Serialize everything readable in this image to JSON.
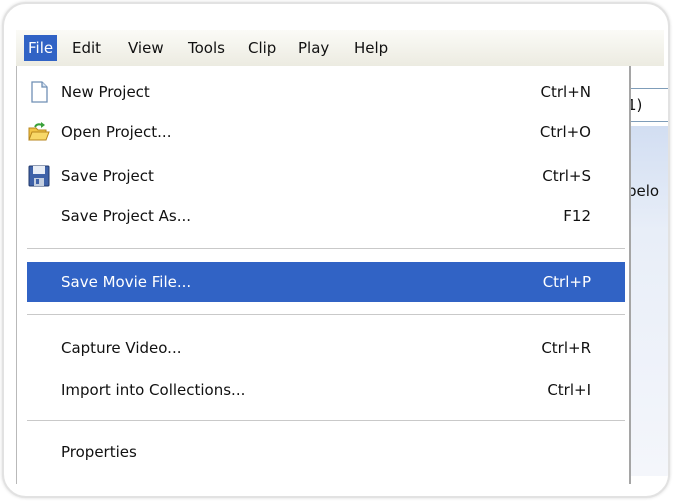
{
  "menubar": {
    "items": [
      {
        "label": "File",
        "active": true
      },
      {
        "label": "Edit"
      },
      {
        "label": "View"
      },
      {
        "label": "Tools"
      },
      {
        "label": "Clip"
      },
      {
        "label": "Play"
      },
      {
        "label": "Help"
      }
    ]
  },
  "background": {
    "combo_text": "1)",
    "panel_text": "belo"
  },
  "file_menu": {
    "items": [
      {
        "label": "New Project",
        "shortcut": "Ctrl+N",
        "icon": "new-document-icon"
      },
      {
        "label": "Open Project...",
        "shortcut": "Ctrl+O",
        "icon": "open-folder-icon"
      },
      {
        "label": "Save Project",
        "shortcut": "Ctrl+S",
        "icon": "floppy-disk-icon"
      },
      {
        "label": "Save Project As...",
        "shortcut": "F12"
      },
      {
        "label": "Save Movie File...",
        "shortcut": "Ctrl+P",
        "highlighted": true
      },
      {
        "label": "Capture Video...",
        "shortcut": "Ctrl+R"
      },
      {
        "label": "Import into Collections...",
        "shortcut": "Ctrl+I"
      },
      {
        "label": "Properties",
        "shortcut": ""
      }
    ]
  },
  "colors": {
    "highlight": "#3163c5",
    "menubar_bg": "#ecebe1"
  }
}
